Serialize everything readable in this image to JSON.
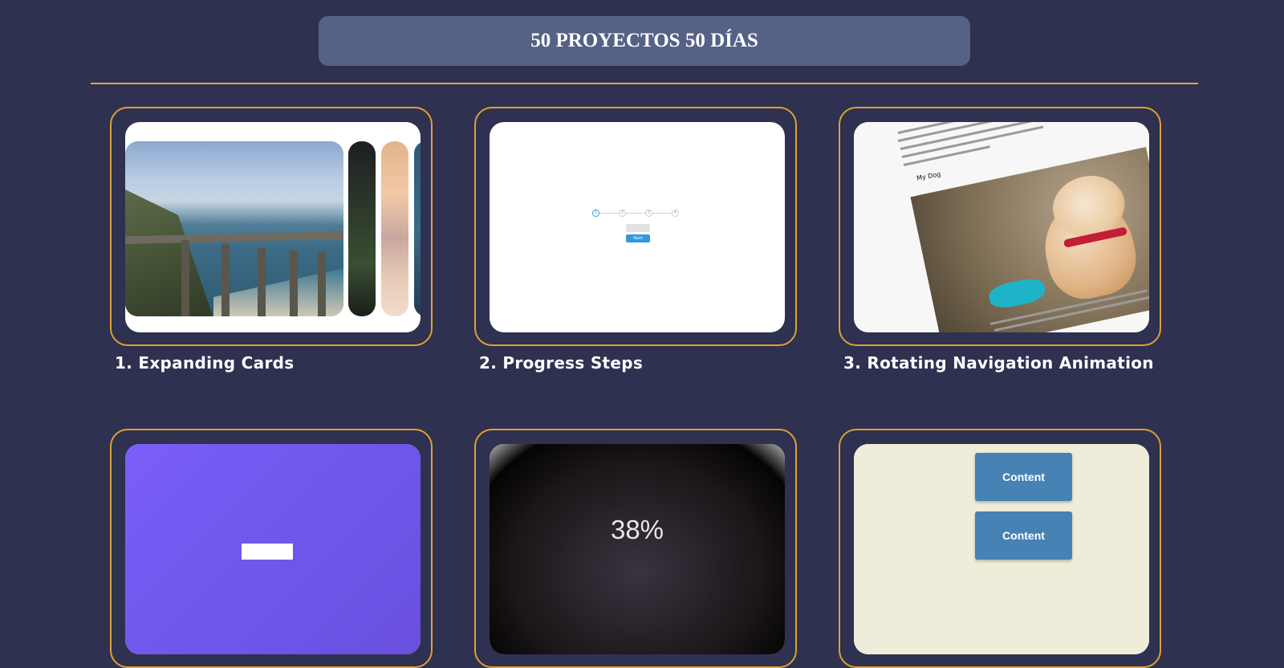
{
  "header": {
    "title": "50 PROYECTOS 50 DÍAS"
  },
  "colors": {
    "background": "#2e3150",
    "header_bg": "#556185",
    "accent": "#e8a33a"
  },
  "projects": [
    {
      "title": "1. Expanding Cards"
    },
    {
      "title": "2. Progress Steps",
      "preview": {
        "steps": [
          "1",
          "2",
          "3",
          "4"
        ],
        "next_label": "Next"
      }
    },
    {
      "title": "3. Rotating Navigation Animation",
      "preview": {
        "heading": "My Dog"
      }
    },
    {
      "title": ""
    },
    {
      "title": "",
      "preview": {
        "percent_label": "38%"
      }
    },
    {
      "title": "",
      "preview": {
        "boxes": [
          "Content",
          "Content"
        ]
      }
    }
  ]
}
